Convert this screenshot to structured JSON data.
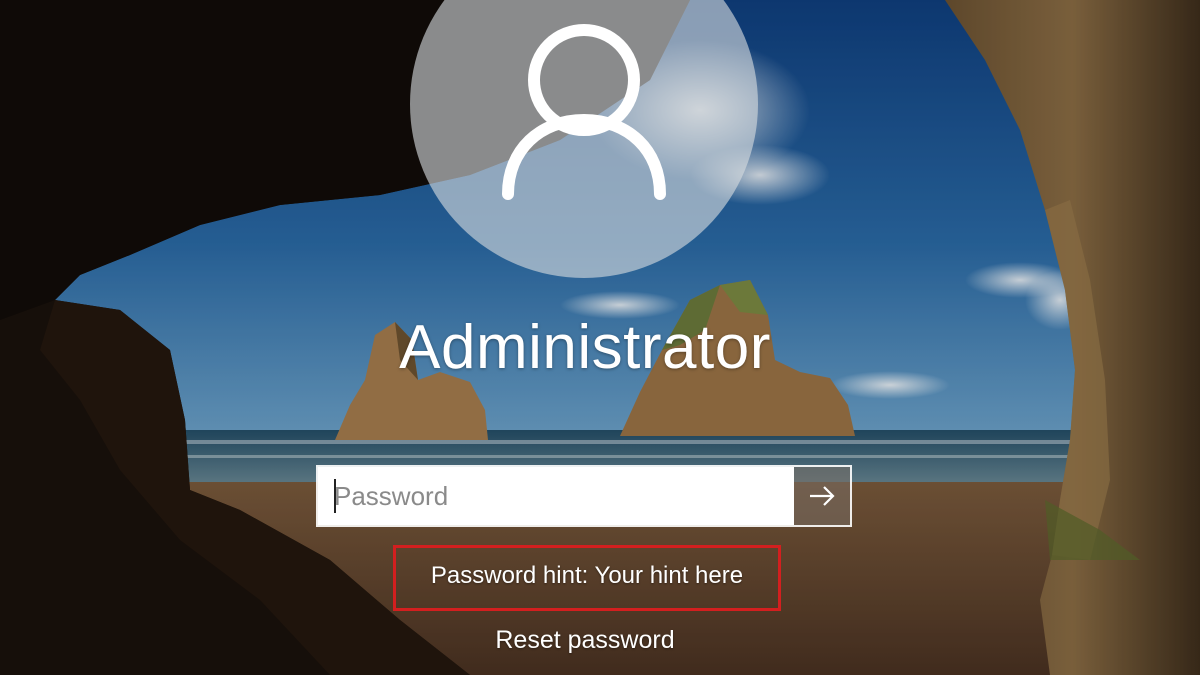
{
  "user": {
    "name": "Administrator",
    "avatar_icon": "user-silhouette-icon"
  },
  "password": {
    "placeholder": "Password",
    "value": "",
    "submit_icon": "arrow-right-icon"
  },
  "hint": {
    "text": "Password hint: Your hint here",
    "highlight_color": "#d31f1f"
  },
  "reset": {
    "label": "Reset password"
  },
  "background": {
    "description_icon": "cave-beach-wallpaper"
  }
}
